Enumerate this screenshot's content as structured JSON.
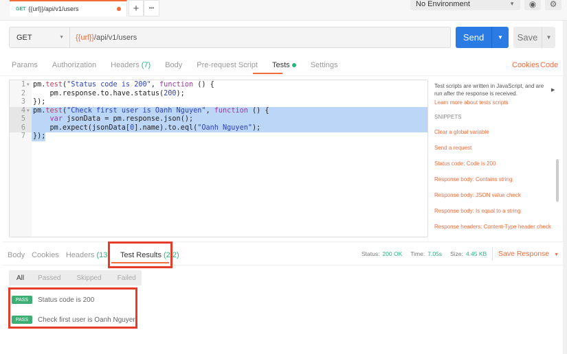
{
  "request_tab": {
    "method": "GET",
    "title": "{{url}}/api/v1/users"
  },
  "topbar": {
    "plus": "+",
    "more": "•••",
    "environment": "No Environment",
    "eye_icon": "◉",
    "gear_icon": "⚙"
  },
  "url_bar": {
    "method": "GET",
    "url_var": "{{url}}",
    "url_path": "/api/v1/users",
    "send": "Send",
    "save": "Save"
  },
  "request_tabs": [
    {
      "label": "Params"
    },
    {
      "label": "Authorization"
    },
    {
      "label": "Headers",
      "count": "(7)"
    },
    {
      "label": "Body"
    },
    {
      "label": "Pre-request Script"
    },
    {
      "label": "Tests",
      "active": true
    },
    {
      "label": "Settings"
    }
  ],
  "request_links": {
    "cookies": "Cookies",
    "code": "Code"
  },
  "editor": {
    "lines": [
      "pm.test(\"Status code is 200\", function () {",
      "    pm.response.to.have.status(200);",
      "});",
      "pm.test(\"Check first user is Oanh Nguyen\", function () {",
      "    var jsonData = pm.response.json();",
      "    pm.expect(jsonData[0].name).to.eql(\"Oanh Nguyen\");",
      "});"
    ],
    "highlighted_lines": [
      4,
      5,
      6,
      7
    ]
  },
  "side_panel": {
    "description": "Test scripts are written in JavaScript, and are run after the response is received.",
    "learn_more": "Learn more about tests scripts",
    "snippets_title": "SNIPPETS",
    "snippets": [
      "Clear a global variable",
      "Send a request",
      "Status code: Code is 200",
      "Response body: Contains string",
      "Response body: JSON value check",
      "Response body: Is equal to a string",
      "Response headers: Content-Type header check"
    ]
  },
  "response_tabs": [
    {
      "label": "Body"
    },
    {
      "label": "Cookies"
    },
    {
      "label": "Headers",
      "count": "(13)"
    },
    {
      "label": "Test Results",
      "count": "(2/2)",
      "active": true
    }
  ],
  "response_meta": {
    "status_label": "Status:",
    "status": "200 OK",
    "time_label": "Time:",
    "time": "7.05s",
    "size_label": "Size:",
    "size": "4.45 KB",
    "save_response": "Save Response"
  },
  "filters": [
    "All",
    "Passed",
    "Skipped",
    "Failed"
  ],
  "results": [
    {
      "status": "PASS",
      "name": "Status code is 200"
    },
    {
      "status": "PASS",
      "name": "Check first user is Oanh Nguyen"
    }
  ],
  "colors": {
    "accent": "#f26b3a",
    "send": "#2a7be4",
    "pass": "#3fae75",
    "highlight": "#e53c2a"
  }
}
